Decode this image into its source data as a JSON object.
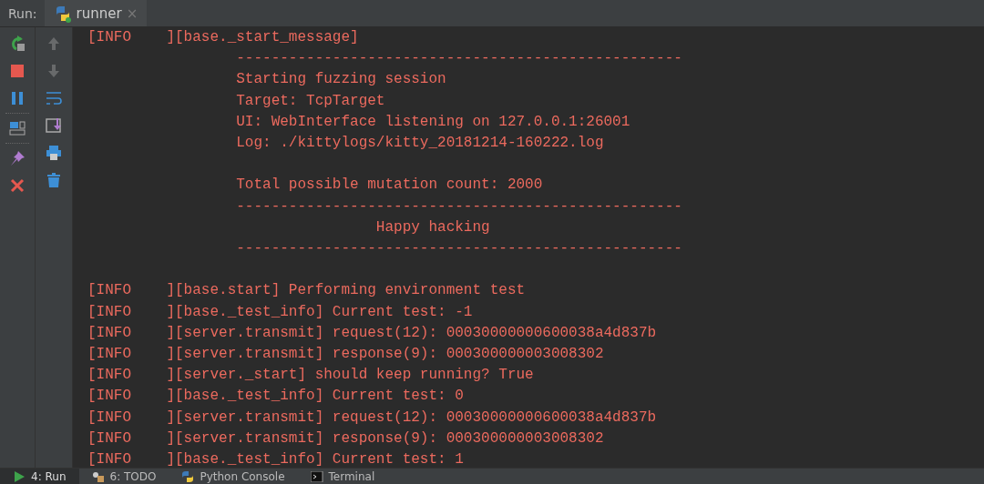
{
  "run_bar": {
    "label": "Run:",
    "tab": {
      "title": "runner",
      "close": "×"
    }
  },
  "toolbar_main": [
    {
      "kind": "rerun",
      "disabled": false
    },
    {
      "kind": "stop",
      "disabled": false
    },
    {
      "kind": "pause",
      "disabled": false
    },
    {
      "kind": "layout",
      "disabled": false
    },
    {
      "kind": "pin",
      "disabled": false
    },
    {
      "kind": "close",
      "disabled": false
    }
  ],
  "toolbar_side": [
    {
      "kind": "up",
      "disabled": true
    },
    {
      "kind": "down",
      "disabled": true
    },
    {
      "kind": "wrap",
      "disabled": false
    },
    {
      "kind": "scroll-end",
      "disabled": false
    },
    {
      "kind": "print",
      "disabled": false
    },
    {
      "kind": "trash",
      "disabled": false
    }
  ],
  "console": {
    "blocks": [
      [
        "[INFO    ][base._start_message]",
        "                 ---------------------------------------------------",
        "                 Starting fuzzing session",
        "                 Target: TcpTarget",
        "                 UI: WebInterface listening on 127.0.0.1:26001",
        "                 Log: ./kittylogs/kitty_20181214-160222.log"
      ],
      [
        "                 Total possible mutation count: 2000",
        "                 ---------------------------------------------------",
        "                                 Happy hacking",
        "                 ---------------------------------------------------"
      ],
      [
        "[INFO    ][base.start] Performing environment test",
        "[INFO    ][base._test_info] Current test: -1",
        "[INFO    ][server.transmit] request(12): 00030000000600038a4d837b",
        "[INFO    ][server.transmit] response(9): 000300000003008302",
        "[INFO    ][server._start] should keep running? True",
        "[INFO    ][base._test_info] Current test: 0",
        "[INFO    ][server.transmit] request(12): 00030000000600038a4d837b",
        "[INFO    ][server.transmit] response(9): 000300000003008302",
        "[INFO    ][base._test_info] Current test: 1"
      ]
    ]
  },
  "bottom_tabs": [
    {
      "label": "4: Run",
      "kind": "run",
      "selected": true
    },
    {
      "label": "6: TODO",
      "kind": "todo",
      "selected": false
    },
    {
      "label": "Python Console",
      "kind": "python",
      "selected": false
    },
    {
      "label": "Terminal",
      "kind": "terminal",
      "selected": false
    }
  ]
}
